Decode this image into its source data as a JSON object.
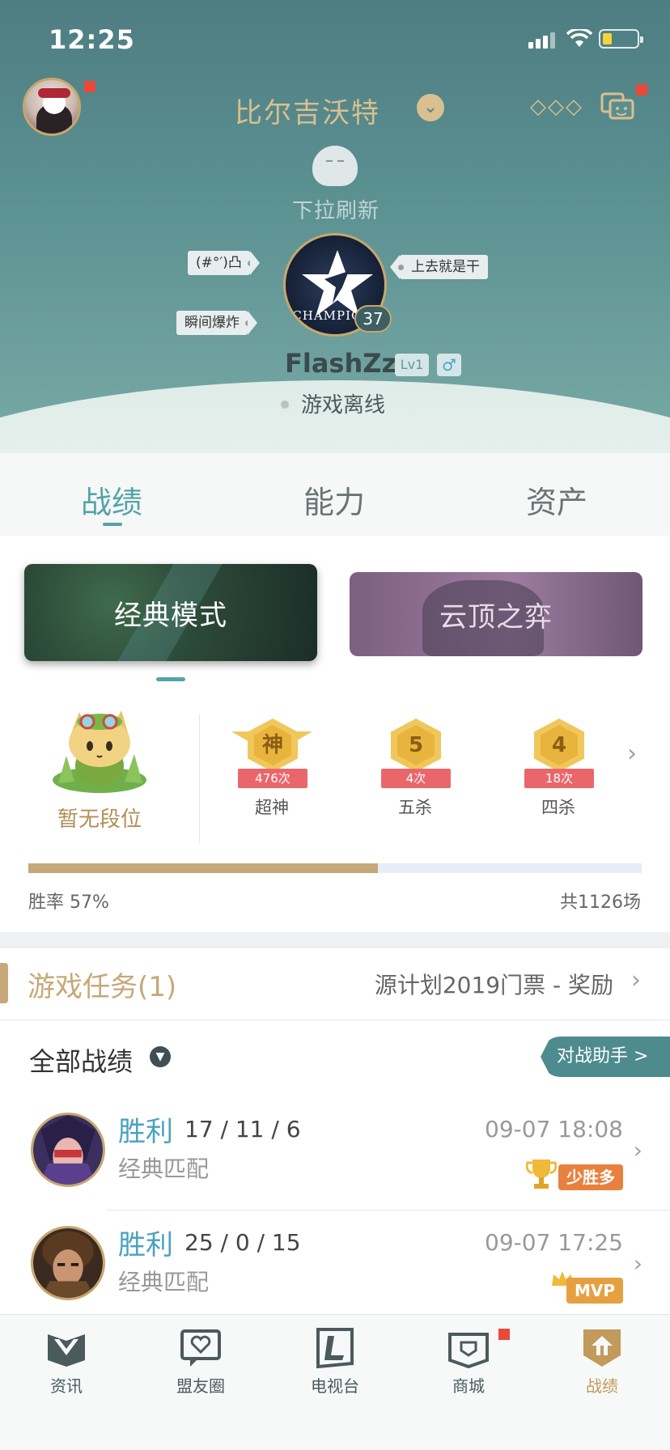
{
  "status_bar": {
    "time": "12:25"
  },
  "header": {
    "server_name": "比尔吉沃特",
    "refresh_hint": "下拉刷新",
    "tags": [
      "(#°′)凸",
      "瞬间爆炸",
      "上去就是干"
    ],
    "emblem_text": "CHAMPIONS",
    "level": "37",
    "nickname": "FlashZz",
    "lv_badge": "Lv1",
    "gender": "♂",
    "status": "游戏离线"
  },
  "main_tabs": [
    {
      "label": "战绩",
      "active": true
    },
    {
      "label": "能力",
      "active": false
    },
    {
      "label": "资产",
      "active": false
    }
  ],
  "modes": [
    {
      "label": "经典模式",
      "active": true
    },
    {
      "label": "云顶之弈",
      "active": false
    }
  ],
  "rank": {
    "label": "暂无段位"
  },
  "honors": [
    {
      "glyph": "神",
      "count": "476次",
      "name": "超神"
    },
    {
      "glyph": "5",
      "count": "4次",
      "name": "五杀"
    },
    {
      "glyph": "4",
      "count": "18次",
      "name": "四杀"
    }
  ],
  "stats": {
    "win_rate_label": "胜率 57%",
    "win_rate": 0.57,
    "total": "共1126场"
  },
  "mission": {
    "title": "游戏任务(1)",
    "desc": "源计划2019门票 - 奖励"
  },
  "matches": {
    "title": "全部战绩",
    "assistant_label": "对战助手 >",
    "rows": [
      {
        "result": "胜利",
        "kda": "17 / 11 / 6",
        "mode": "经典匹配",
        "time": "09-07 18:08",
        "badge": "少胜多"
      },
      {
        "result": "胜利",
        "kda": "25 / 0 / 15",
        "mode": "经典匹配",
        "time": "09-07 17:25",
        "badge": "MVP"
      }
    ]
  },
  "bottom_nav": [
    {
      "label": "资讯",
      "active": false
    },
    {
      "label": "盟友圈",
      "active": false
    },
    {
      "label": "电视台",
      "active": false
    },
    {
      "label": "商城",
      "active": false
    },
    {
      "label": "战绩",
      "active": true
    }
  ],
  "colors": {
    "teal": "#54a3a8",
    "gold": "#c6a879",
    "accent_red": "#e84a3a"
  }
}
